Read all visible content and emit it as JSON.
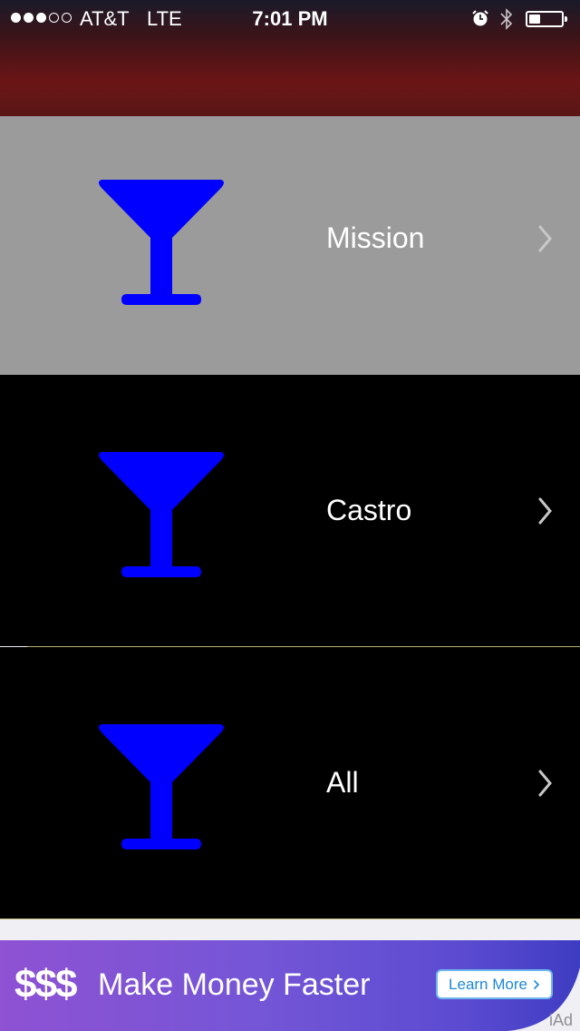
{
  "status_bar": {
    "carrier": "AT&T",
    "network": "LTE",
    "time": "7:01 PM",
    "signal_bars_filled": 3,
    "signal_bars_total": 5,
    "battery_level": 0.3
  },
  "list": {
    "items": [
      {
        "label": "Mission",
        "icon": "cocktail-glass-icon",
        "selected": true
      },
      {
        "label": "Castro",
        "icon": "cocktail-glass-icon",
        "selected": false
      },
      {
        "label": "All",
        "icon": "cocktail-glass-icon",
        "selected": false
      }
    ]
  },
  "ad": {
    "dollars": "$$$",
    "headline": "Make Money Faster",
    "button_label": "Learn More",
    "badge": "iAd"
  },
  "colors": {
    "icon": "#0000ff",
    "selected_row": "#9b9b9b",
    "row_background": "#000000",
    "separator": "#b8b070"
  }
}
